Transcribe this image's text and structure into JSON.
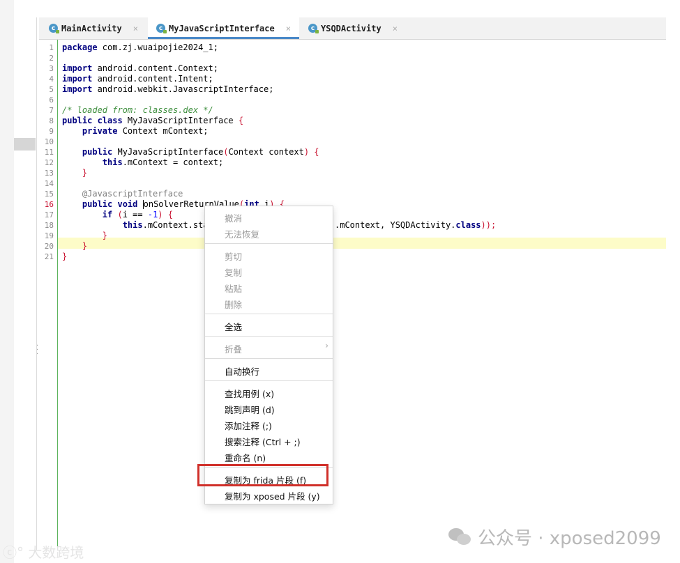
{
  "tabs": [
    {
      "label": "MainActivity",
      "icon": "class-icon",
      "close": "×"
    },
    {
      "label": "MyJavaScriptInterface",
      "icon": "class-icon",
      "close": "×",
      "active": true
    },
    {
      "label": "YSQDActivity",
      "icon": "class-icon",
      "close": "×"
    }
  ],
  "class_icon_glyph": "c",
  "line_numbers": [
    "1",
    "2",
    "3",
    "4",
    "5",
    "6",
    "7",
    "8",
    "9",
    "10",
    "11",
    "12",
    "13",
    "14",
    "15",
    "16",
    "17",
    "18",
    "19",
    "20",
    "21"
  ],
  "code": {
    "l1_kw": "package",
    "l1_rest": " com.zj.wuaipojie2024_1;",
    "l3_kw": "import",
    "l3_rest": " android.content.Context;",
    "l4_kw": "import",
    "l4_rest": " android.content.Intent;",
    "l5_kw": "import",
    "l5_rest": " android.webkit.JavascriptInterface;",
    "l7": "/* loaded from: classes.dex */",
    "l8_kw": "public class",
    "l8_name": " MyJavaScriptInterface ",
    "l8_br": "{",
    "l9_ind": "    ",
    "l9_kw": "private",
    "l9_rest": " Context mContext;",
    "l11_ind": "    ",
    "l11_kw": "public",
    "l11_rest": " MyJavaScriptInterface",
    "l11_p1": "(",
    "l11_args": "Context context",
    "l11_p2": ")",
    "l11_sp": " ",
    "l11_br": "{",
    "l12_ind": "        ",
    "l12_kw": "this",
    "l12_rest": ".mContext = context;",
    "l13_ind": "    ",
    "l13_br": "}",
    "l15_ind": "    ",
    "l15_an": "@JavascriptInterface",
    "l16_ind": "    ",
    "l16_kw": "public void",
    "l16_sp": " ",
    "l16_c1": "o",
    "l16_rest": "nSolverReturnValue",
    "l16_p1": "(",
    "l16_kw2": "int",
    "l16_arg": " i",
    "l16_p2": ")",
    "l16_sp2": " ",
    "l16_br": "{",
    "l17_ind": "        ",
    "l17_kw": "if",
    "l17_sp": " ",
    "l17_p1": "(",
    "l17_mid": "i == ",
    "l17_num": "-1",
    "l17_p2": ")",
    "l17_sp2": " ",
    "l17_br": "{",
    "l18_ind": "            ",
    "l18_kw": "this",
    "l18_rest": ".mContext.sta",
    "l18_tail": ".mContext, YSQDActivity.",
    "l18_kw2": "class",
    "l18_end": "));",
    "l19_ind": "        ",
    "l19_br": "}",
    "l20_ind": "    ",
    "l20_br": "}",
    "l21_br": "}"
  },
  "context_menu": {
    "undo": "撤消",
    "redo": "无法恢复",
    "cut": "剪切",
    "copy": "复制",
    "paste": "粘贴",
    "delete": "删除",
    "select_all": "全选",
    "fold": "折叠",
    "fold_arrow": "›",
    "word_wrap": "自动换行",
    "find_usages": "查找用例 (x)",
    "goto_declaration": "跳到声明 (d)",
    "add_comment": "添加注释 (;)",
    "search_comment": "搜索注释 (Ctrl + ;)",
    "rename": "重命名 (n)",
    "copy_frida": "复制为 frida 片段 (f)",
    "copy_xposed": "复制为 xposed 片段 (y)"
  },
  "watermark_right": "公众号 · xposed2099",
  "watermark_left": "大数跨境",
  "watermark_left_mark": "ⓒ°"
}
